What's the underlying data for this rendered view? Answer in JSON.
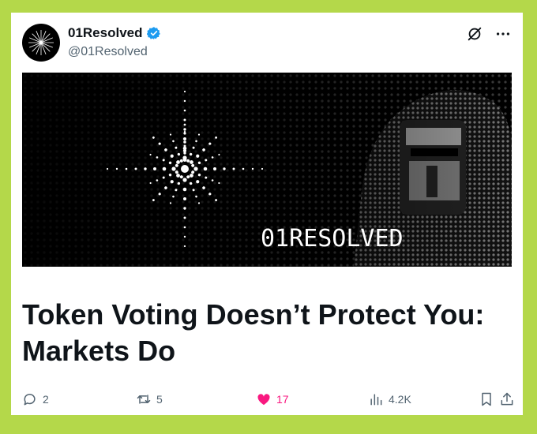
{
  "post": {
    "author_name": "01Resolved",
    "handle": "@01Resolved",
    "banner_text": "01RESOLVED",
    "headline": "Token Voting Doesn’t Protect You: Markets Do"
  },
  "actions": {
    "replies": "2",
    "reposts": "5",
    "likes": "17",
    "views": "4.2K"
  },
  "colors": {
    "page_background": "#b4d84a",
    "verified": "#1d9bf0",
    "like": "#f91880",
    "muted": "#536471"
  },
  "icons": [
    "verified-badge-icon",
    "grok-icon",
    "more-icon",
    "reply-icon",
    "repost-icon",
    "like-icon",
    "views-icon",
    "bookmark-icon",
    "share-icon"
  ]
}
